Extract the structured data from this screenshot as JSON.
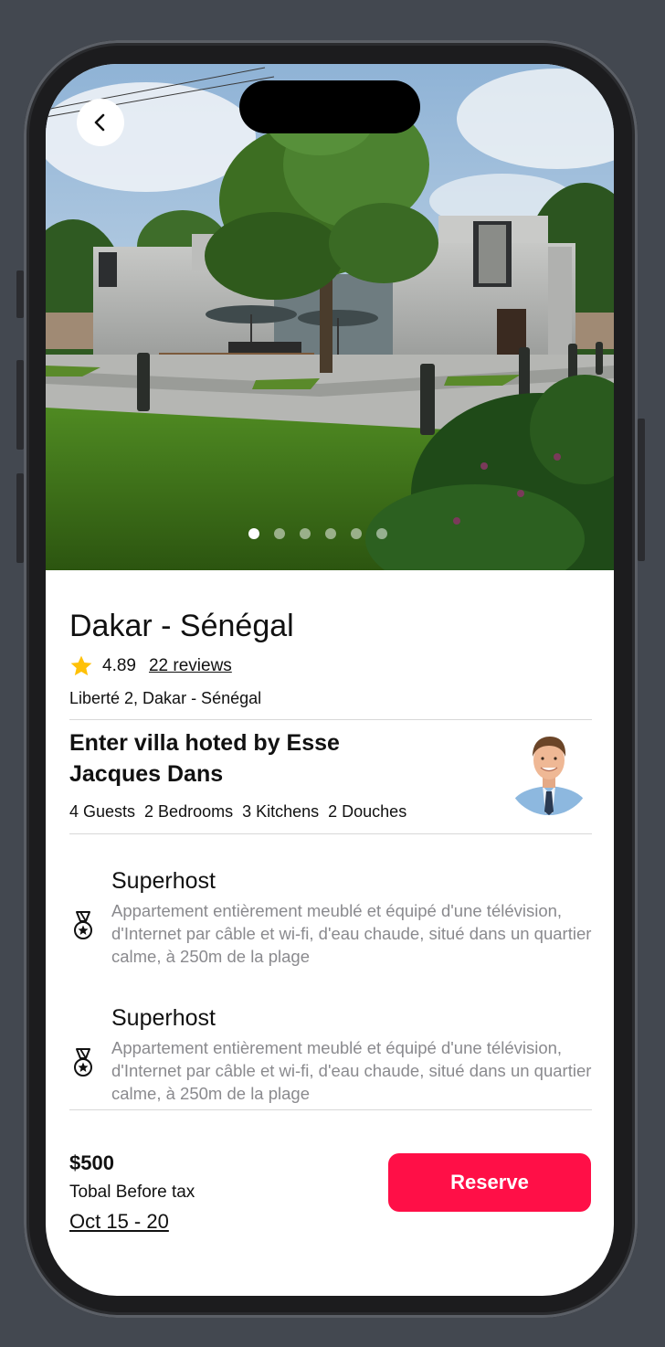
{
  "listing": {
    "title": "Dakar - Sénégal",
    "rating": "4.89",
    "reviews_label": "22 reviews",
    "address": "Liberté 2, Dakar - Sénégal"
  },
  "host": {
    "title": "Enter villa hoted by Esse Jacques Dans",
    "stats": "4 Guests  2 Bedrooms  3 Kitchens  2 Douches"
  },
  "features": [
    {
      "title": "Superhost",
      "description": "Appartement entièrement meublé et équipé d'une télévision, d'Internet par câble et wi-fi, d'eau chaude, situé dans un quartier calme, à 250m de la plage",
      "icon": "medal-icon"
    },
    {
      "title": "Superhost",
      "description": "Appartement entièrement meublé et équipé d'une télévision, d'Internet par câble et wi-fi, d'eau chaude, situé dans un quartier calme, à 250m de la plage",
      "icon": "medal-icon"
    }
  ],
  "footer": {
    "price": "$500",
    "price_note": "Tobal Before tax",
    "dates": "Oct 15 - 20",
    "reserve_label": "Reserve"
  },
  "gallery": {
    "total_images": 6,
    "active_index": 0
  },
  "colors": {
    "accent": "#ff0f47",
    "star": "#ffc107",
    "muted_text": "#8a8a8e"
  }
}
